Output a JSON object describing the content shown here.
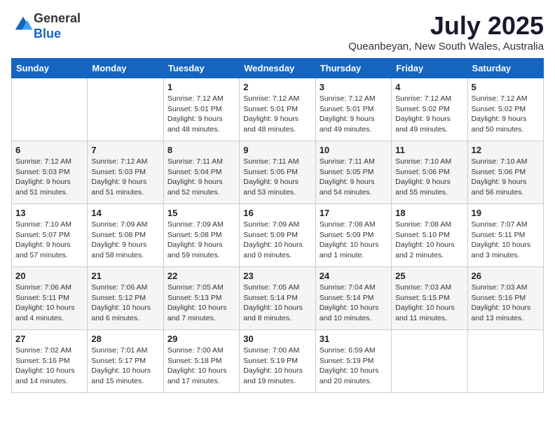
{
  "logo": {
    "general": "General",
    "blue": "Blue"
  },
  "title": "July 2025",
  "location": "Queanbeyan, New South Wales, Australia",
  "days_header": [
    "Sunday",
    "Monday",
    "Tuesday",
    "Wednesday",
    "Thursday",
    "Friday",
    "Saturday"
  ],
  "weeks": [
    [
      {
        "day": "",
        "info": ""
      },
      {
        "day": "",
        "info": ""
      },
      {
        "day": "1",
        "info": "Sunrise: 7:12 AM\nSunset: 5:01 PM\nDaylight: 9 hours\nand 48 minutes."
      },
      {
        "day": "2",
        "info": "Sunrise: 7:12 AM\nSunset: 5:01 PM\nDaylight: 9 hours\nand 48 minutes."
      },
      {
        "day": "3",
        "info": "Sunrise: 7:12 AM\nSunset: 5:01 PM\nDaylight: 9 hours\nand 49 minutes."
      },
      {
        "day": "4",
        "info": "Sunrise: 7:12 AM\nSunset: 5:02 PM\nDaylight: 9 hours\nand 49 minutes."
      },
      {
        "day": "5",
        "info": "Sunrise: 7:12 AM\nSunset: 5:02 PM\nDaylight: 9 hours\nand 50 minutes."
      }
    ],
    [
      {
        "day": "6",
        "info": "Sunrise: 7:12 AM\nSunset: 5:03 PM\nDaylight: 9 hours\nand 51 minutes."
      },
      {
        "day": "7",
        "info": "Sunrise: 7:12 AM\nSunset: 5:03 PM\nDaylight: 9 hours\nand 51 minutes."
      },
      {
        "day": "8",
        "info": "Sunrise: 7:11 AM\nSunset: 5:04 PM\nDaylight: 9 hours\nand 52 minutes."
      },
      {
        "day": "9",
        "info": "Sunrise: 7:11 AM\nSunset: 5:05 PM\nDaylight: 9 hours\nand 53 minutes."
      },
      {
        "day": "10",
        "info": "Sunrise: 7:11 AM\nSunset: 5:05 PM\nDaylight: 9 hours\nand 54 minutes."
      },
      {
        "day": "11",
        "info": "Sunrise: 7:10 AM\nSunset: 5:06 PM\nDaylight: 9 hours\nand 55 minutes."
      },
      {
        "day": "12",
        "info": "Sunrise: 7:10 AM\nSunset: 5:06 PM\nDaylight: 9 hours\nand 56 minutes."
      }
    ],
    [
      {
        "day": "13",
        "info": "Sunrise: 7:10 AM\nSunset: 5:07 PM\nDaylight: 9 hours\nand 57 minutes."
      },
      {
        "day": "14",
        "info": "Sunrise: 7:09 AM\nSunset: 5:08 PM\nDaylight: 9 hours\nand 58 minutes."
      },
      {
        "day": "15",
        "info": "Sunrise: 7:09 AM\nSunset: 5:08 PM\nDaylight: 9 hours\nand 59 minutes."
      },
      {
        "day": "16",
        "info": "Sunrise: 7:09 AM\nSunset: 5:09 PM\nDaylight: 10 hours\nand 0 minutes."
      },
      {
        "day": "17",
        "info": "Sunrise: 7:08 AM\nSunset: 5:09 PM\nDaylight: 10 hours\nand 1 minute."
      },
      {
        "day": "18",
        "info": "Sunrise: 7:08 AM\nSunset: 5:10 PM\nDaylight: 10 hours\nand 2 minutes."
      },
      {
        "day": "19",
        "info": "Sunrise: 7:07 AM\nSunset: 5:11 PM\nDaylight: 10 hours\nand 3 minutes."
      }
    ],
    [
      {
        "day": "20",
        "info": "Sunrise: 7:06 AM\nSunset: 5:11 PM\nDaylight: 10 hours\nand 4 minutes."
      },
      {
        "day": "21",
        "info": "Sunrise: 7:06 AM\nSunset: 5:12 PM\nDaylight: 10 hours\nand 6 minutes."
      },
      {
        "day": "22",
        "info": "Sunrise: 7:05 AM\nSunset: 5:13 PM\nDaylight: 10 hours\nand 7 minutes."
      },
      {
        "day": "23",
        "info": "Sunrise: 7:05 AM\nSunset: 5:14 PM\nDaylight: 10 hours\nand 8 minutes."
      },
      {
        "day": "24",
        "info": "Sunrise: 7:04 AM\nSunset: 5:14 PM\nDaylight: 10 hours\nand 10 minutes."
      },
      {
        "day": "25",
        "info": "Sunrise: 7:03 AM\nSunset: 5:15 PM\nDaylight: 10 hours\nand 11 minutes."
      },
      {
        "day": "26",
        "info": "Sunrise: 7:03 AM\nSunset: 5:16 PM\nDaylight: 10 hours\nand 13 minutes."
      }
    ],
    [
      {
        "day": "27",
        "info": "Sunrise: 7:02 AM\nSunset: 5:16 PM\nDaylight: 10 hours\nand 14 minutes."
      },
      {
        "day": "28",
        "info": "Sunrise: 7:01 AM\nSunset: 5:17 PM\nDaylight: 10 hours\nand 15 minutes."
      },
      {
        "day": "29",
        "info": "Sunrise: 7:00 AM\nSunset: 5:18 PM\nDaylight: 10 hours\nand 17 minutes."
      },
      {
        "day": "30",
        "info": "Sunrise: 7:00 AM\nSunset: 5:19 PM\nDaylight: 10 hours\nand 19 minutes."
      },
      {
        "day": "31",
        "info": "Sunrise: 6:59 AM\nSunset: 5:19 PM\nDaylight: 10 hours\nand 20 minutes."
      },
      {
        "day": "",
        "info": ""
      },
      {
        "day": "",
        "info": ""
      }
    ]
  ]
}
